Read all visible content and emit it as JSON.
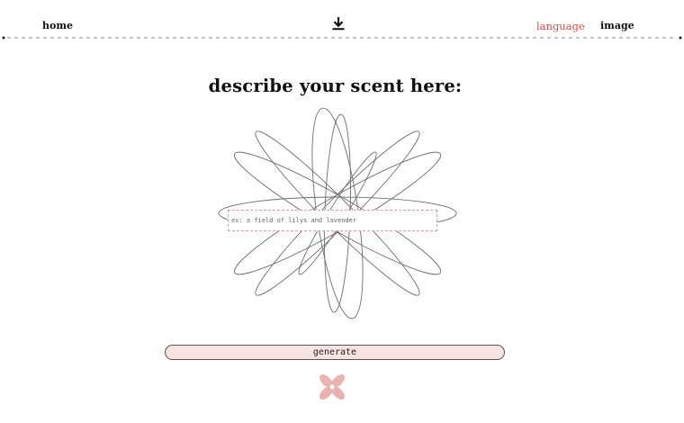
{
  "nav": {
    "home_label": "home",
    "language_label": "language",
    "image_label": "image",
    "download_icon": "download-icon"
  },
  "main": {
    "heading": "describe your scent here:",
    "input": {
      "placeholder": "ex: a field of lilys and lavender",
      "value": ""
    },
    "generate_label": "generate"
  },
  "colors": {
    "active_nav": "#e2483d",
    "input_border": "#e59a9a",
    "button_fill": "#f7e4e2",
    "blossom": "#eab3b0",
    "flower_stroke": "#6e6e6e"
  }
}
